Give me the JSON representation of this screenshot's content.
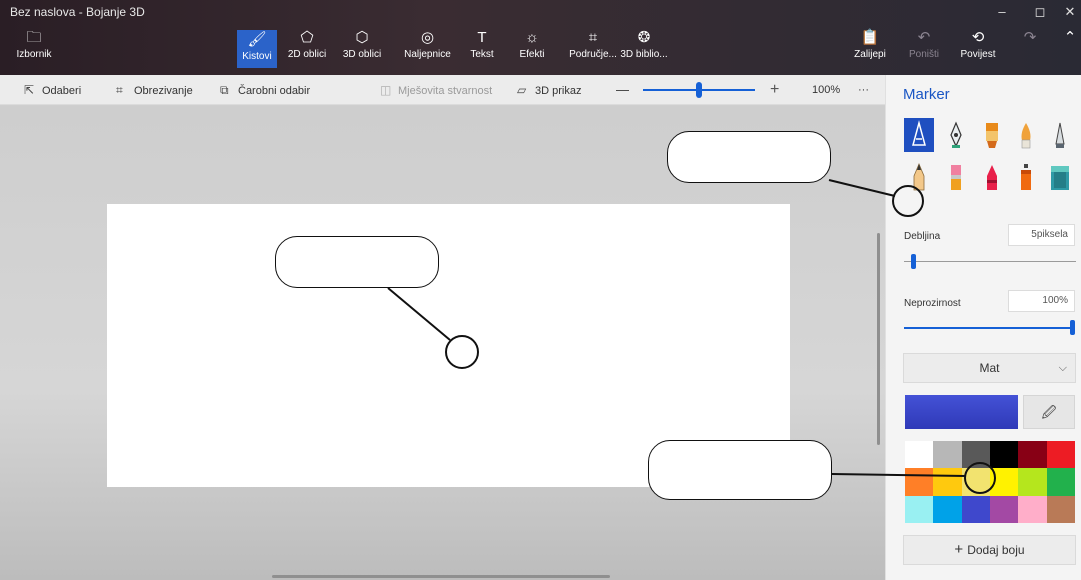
{
  "window": {
    "title": "Bez naslova - Bojanje 3D",
    "controls": [
      "–",
      "◻",
      "✕"
    ]
  },
  "ribbon": {
    "items": [
      {
        "label": "Izbornik",
        "icon": "folder-icon",
        "glyph": "🗀"
      },
      {
        "label": "Kistovi",
        "icon": "brush-icon",
        "glyph": "🖌",
        "active": true
      },
      {
        "label": "2D oblici",
        "icon": "shapes-2d-icon",
        "glyph": "⬠"
      },
      {
        "label": "3D oblici",
        "icon": "cube-icon",
        "glyph": "⬡"
      },
      {
        "label": "Naljepnice",
        "icon": "sticker-icon",
        "glyph": "◎"
      },
      {
        "label": "Tekst",
        "icon": "text-icon",
        "glyph": "T"
      },
      {
        "label": "Efekti",
        "icon": "effects-icon",
        "glyph": "☼"
      },
      {
        "label": "Područje...",
        "icon": "crop-canvas-icon",
        "glyph": "⌗"
      },
      {
        "label": "3D biblio...",
        "icon": "library-3d-icon",
        "glyph": "❂"
      },
      {
        "label": "Zalijepi",
        "icon": "paste-icon",
        "glyph": "📋"
      },
      {
        "label": "Poništi",
        "icon": "undo-icon",
        "glyph": "↶",
        "disabled": true
      },
      {
        "label": "Povijest",
        "icon": "history-icon",
        "glyph": "⟲"
      },
      {
        "label": "",
        "icon": "redo-icon",
        "glyph": "↷",
        "disabled": true
      },
      {
        "label": "",
        "icon": "collapse-icon",
        "glyph": "⌃"
      }
    ]
  },
  "toolbar": {
    "select": "Odaberi",
    "crop": "Obrezivanje",
    "magic_select": "Čarobni odabir",
    "mixed_reality": "Mješovita stvarnost",
    "view_3d": "3D prikaz",
    "zoom_out": "—",
    "zoom_in": "+",
    "zoom": "100%",
    "more": "···"
  },
  "zoom_level": 0.5,
  "panel": {
    "title": "Marker",
    "thickness_label": "Debljina",
    "thickness_value": "5piksela",
    "thickness_level": 0.05,
    "opacity_label": "Neprozirnost",
    "opacity_value": "100%",
    "opacity_level": 1.0,
    "finish": "Mat",
    "finish_chevron": "⌵",
    "current_color": "#2f39b8",
    "add_color": "Dodaj boju",
    "add_glyph": "+",
    "brushes": [
      {
        "name": "marker",
        "selected": true
      },
      {
        "name": "calligraphy-pen"
      },
      {
        "name": "oil-brush"
      },
      {
        "name": "watercolor"
      },
      {
        "name": "pixel-pen"
      },
      {
        "name": "pencil"
      },
      {
        "name": "eraser"
      },
      {
        "name": "crayon"
      },
      {
        "name": "spray-can"
      },
      {
        "name": "fill-bucket"
      }
    ],
    "palette": [
      "#ffffff",
      "#b7b7b7",
      "#595959",
      "#000000",
      "#880015",
      "#ed1c24",
      "#ff7f27",
      "#ffc90e",
      "#f2e36f",
      "#fff200",
      "#b5e61d",
      "#22b14c",
      "#99f0f2",
      "#00a2e8",
      "#3f48cc",
      "#a349a4",
      "#ffaec9",
      "#b97a57"
    ]
  }
}
